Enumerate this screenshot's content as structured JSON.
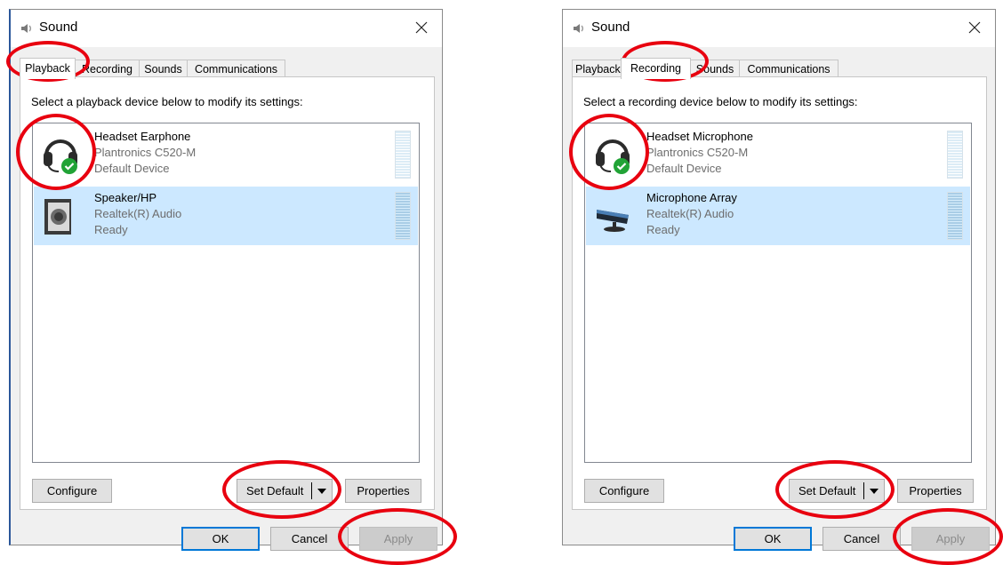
{
  "colors": {
    "highlight": "#e8000f",
    "selection": "#cce8ff",
    "default_check": "#21a336"
  },
  "playback_dialog": {
    "title": "Sound",
    "tabs": [
      {
        "label": "Playback",
        "active": true
      },
      {
        "label": "Recording",
        "active": false
      },
      {
        "label": "Sounds",
        "active": false
      },
      {
        "label": "Communications",
        "active": false
      }
    ],
    "instruction": "Select a playback device below to modify its settings:",
    "devices": [
      {
        "name": "Headset Earphone",
        "subtitle": "Plantronics C520-M",
        "status": "Default Device",
        "icon": "headset-icon",
        "selected": false,
        "default": true
      },
      {
        "name": "Speaker/HP",
        "subtitle": "Realtek(R) Audio",
        "status": "Ready",
        "icon": "speaker-icon",
        "selected": true,
        "default": false
      }
    ],
    "buttons": {
      "configure": "Configure",
      "set_default": "Set Default",
      "properties": "Properties",
      "ok": "OK",
      "cancel": "Cancel",
      "apply": "Apply"
    }
  },
  "recording_dialog": {
    "title": "Sound",
    "tabs": [
      {
        "label": "Playback",
        "active": false
      },
      {
        "label": "Recording",
        "active": true
      },
      {
        "label": "Sounds",
        "active": false
      },
      {
        "label": "Communications",
        "active": false
      }
    ],
    "instruction": "Select a recording device below to modify its settings:",
    "devices": [
      {
        "name": "Headset Microphone",
        "subtitle": "Plantronics C520-M",
        "status": "Default Device",
        "icon": "headset-icon",
        "selected": false,
        "default": true
      },
      {
        "name": "Microphone Array",
        "subtitle": "Realtek(R) Audio",
        "status": "Ready",
        "icon": "microphone-array-icon",
        "selected": true,
        "default": false
      }
    ],
    "buttons": {
      "configure": "Configure",
      "set_default": "Set Default",
      "properties": "Properties",
      "ok": "OK",
      "cancel": "Cancel",
      "apply": "Apply"
    }
  }
}
